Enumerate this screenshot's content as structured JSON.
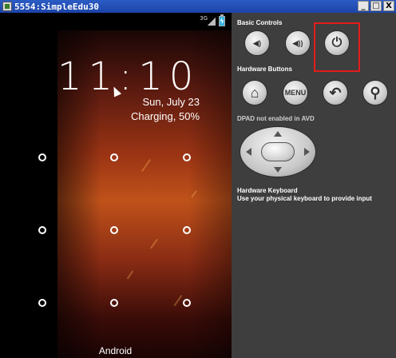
{
  "window": {
    "title": "5554:SimpleEdu30",
    "minimize_glyph": "_",
    "maximize_glyph": "□",
    "close_glyph": "X"
  },
  "phone": {
    "status_network": "3G",
    "clock": "11:10",
    "date": "Sun, July 23",
    "charging": "Charging, 50%",
    "carrier": "Android",
    "battery_bolt": "ϟ"
  },
  "panel": {
    "basic_controls_label": "Basic Controls",
    "hardware_buttons_label": "Hardware Buttons",
    "dpad_label": "DPAD not enabled in AVD",
    "keyboard_title": "Hardware Keyboard",
    "keyboard_desc": "Use your physical keyboard to provide input",
    "basic_buttons": [
      {
        "name": "volume-down",
        "icon": "volume-down-icon",
        "glyph": "◀)"
      },
      {
        "name": "volume-up",
        "icon": "volume-up-icon",
        "glyph": "◀))"
      },
      {
        "name": "power",
        "icon": "power-icon",
        "glyph": "⏻"
      }
    ],
    "hardware_buttons": [
      {
        "name": "home",
        "icon": "home-icon",
        "glyph": "⌂"
      },
      {
        "name": "menu",
        "icon": "menu-icon",
        "label": "MENU"
      },
      {
        "name": "back",
        "icon": "back-icon",
        "glyph": "↶"
      },
      {
        "name": "search",
        "icon": "search-icon",
        "glyph": "⚲"
      }
    ]
  },
  "colors": {
    "highlight": "#e51c1c",
    "panel_bg": "#3e3e3e",
    "title_bar": "#2b5cc4"
  }
}
